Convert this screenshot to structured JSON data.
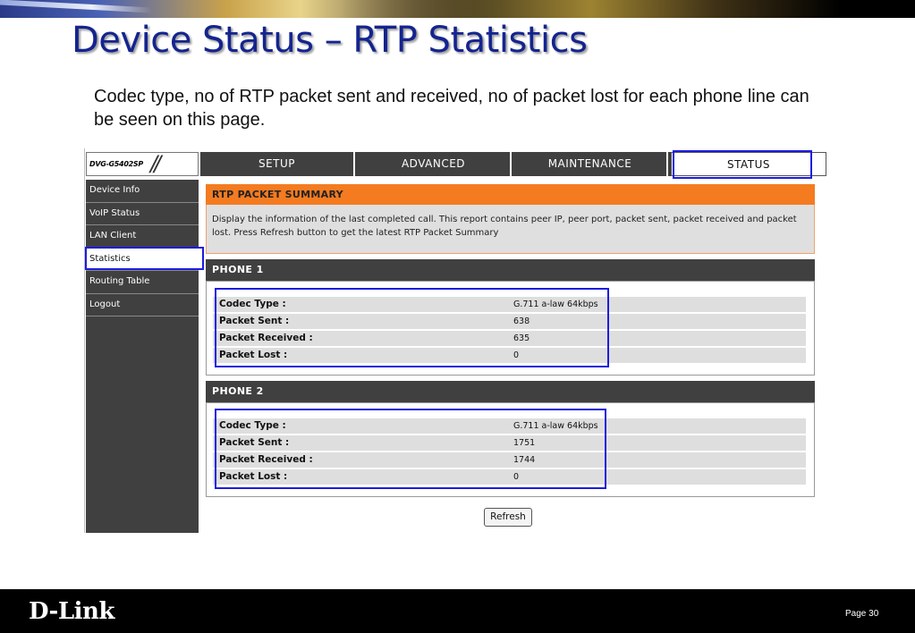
{
  "slide": {
    "title": "Device Status – RTP Statistics",
    "description": "Codec type, no of RTP packet sent and received, no of packet lost for each phone line can be seen on this page.",
    "footer_logo": "D-Link",
    "page_label": "Page 30"
  },
  "ui": {
    "model": "DVG-G5402SP",
    "tabs": [
      {
        "label": "SETUP"
      },
      {
        "label": "ADVANCED"
      },
      {
        "label": "MAINTENANCE"
      },
      {
        "label": "STATUS",
        "active": true
      }
    ],
    "sidebar": [
      {
        "label": "Device Info"
      },
      {
        "label": "VoIP Status"
      },
      {
        "label": "LAN Client"
      },
      {
        "label": "Statistics",
        "active": true
      },
      {
        "label": "Routing Table"
      },
      {
        "label": "Logout"
      }
    ],
    "summary": {
      "title": "RTP PACKET SUMMARY",
      "text": "Display the information of the last completed call. This report contains peer IP, peer port, packet sent, packet received and packet lost. Press Refresh button to get the latest RTP Packet Summary"
    },
    "phones": [
      {
        "title": "PHONE 1",
        "rows": [
          {
            "label": "Codec Type :",
            "value": "G.711 a-law 64kbps"
          },
          {
            "label": "Packet Sent :",
            "value": "638"
          },
          {
            "label": "Packet Received :",
            "value": "635"
          },
          {
            "label": "Packet Lost :",
            "value": "0"
          }
        ]
      },
      {
        "title": "PHONE 2",
        "rows": [
          {
            "label": "Codec Type :",
            "value": "G.711 a-law 64kbps"
          },
          {
            "label": "Packet Sent :",
            "value": "1751"
          },
          {
            "label": "Packet Received :",
            "value": "1744"
          },
          {
            "label": "Packet Lost :",
            "value": "0"
          }
        ]
      }
    ],
    "refresh_label": "Refresh"
  },
  "colors": {
    "title": "#14248f",
    "orange_header": "#f47b20",
    "dark_bar": "#404040",
    "highlight": "#1c1ce0"
  }
}
